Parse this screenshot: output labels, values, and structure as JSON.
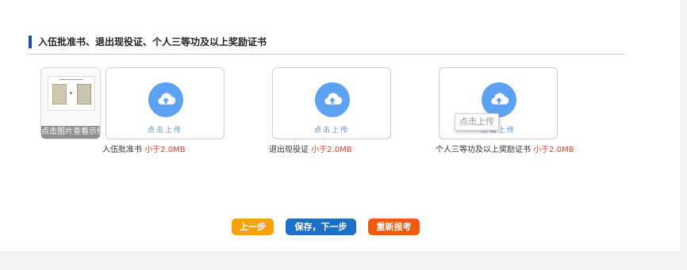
{
  "section": {
    "title": "入伍批准书、退出现役证、个人三等功及以上奖励证书"
  },
  "sample": {
    "caption": "点击图片查看示例"
  },
  "uploads": [
    {
      "button_label": "点击上传",
      "caption": "入伍批准书",
      "limit": "小于2.0MB"
    },
    {
      "button_label": "点击上传",
      "caption": "退出现役证",
      "limit": "小于2.0MB"
    },
    {
      "button_label": "点击上传",
      "caption": "个人三等功及以上奖励证书",
      "limit": "小于2.0MB"
    }
  ],
  "tooltip": {
    "text": "点击上传"
  },
  "actions": {
    "prev": "上一步",
    "save_next": "保存，下一步",
    "restart": "重新报考"
  },
  "colors": {
    "accent_blue": "#1e6fc8",
    "orange": "#f5a20c",
    "red_orange": "#ee5b10",
    "limit_red": "#e23b2e",
    "icon_blue": "#5da2f2"
  },
  "icons": {
    "upload": "cloud-upload-icon"
  }
}
